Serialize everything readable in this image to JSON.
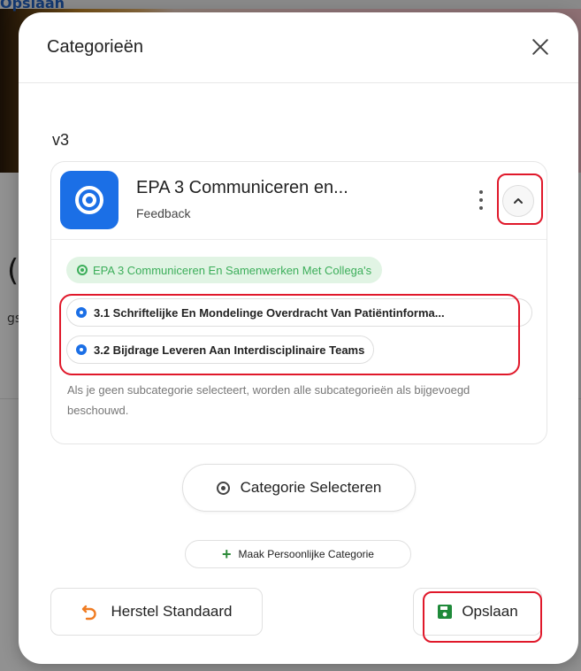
{
  "background": {
    "top_label": "Opslaan",
    "large_text": "(v",
    "small_text": "gs"
  },
  "modal": {
    "title": "Categorieën",
    "version_label": "v3",
    "category": {
      "title": "EPA 3 Communiceren en...",
      "subtitle": "Feedback",
      "main_chip": "EPA 3 Communiceren En Samenwerken Met Collega's",
      "subcategories": [
        {
          "label": "3.1 Schriftelijke En Mondelinge Overdracht Van Patiëntinforma..."
        },
        {
          "label": "3.2 Bijdrage Leveren Aan Interdisciplinaire Teams"
        }
      ],
      "hint": "Als je geen subcategorie selecteert, worden alle subcategorieën als bijgevoegd beschouwd."
    },
    "select_category_label": "Categorie Selecteren",
    "personal_category_label": "Maak Persoonlijke Categorie",
    "reset_label": "Herstel Standaard",
    "save_label": "Opslaan"
  },
  "colors": {
    "accent_blue": "#1b6fe6",
    "green": "#3cae5a",
    "chip_green_bg": "#e1f4e4",
    "highlight_red": "#e0182a",
    "reset_orange": "#f07c22"
  },
  "icons": {
    "close": "close-icon",
    "category": "target-icon",
    "more": "more-vertical-icon",
    "collapse": "chevron-up-icon",
    "select": "target-icon",
    "add": "plus-icon",
    "reset": "undo-icon",
    "save": "save-icon"
  }
}
